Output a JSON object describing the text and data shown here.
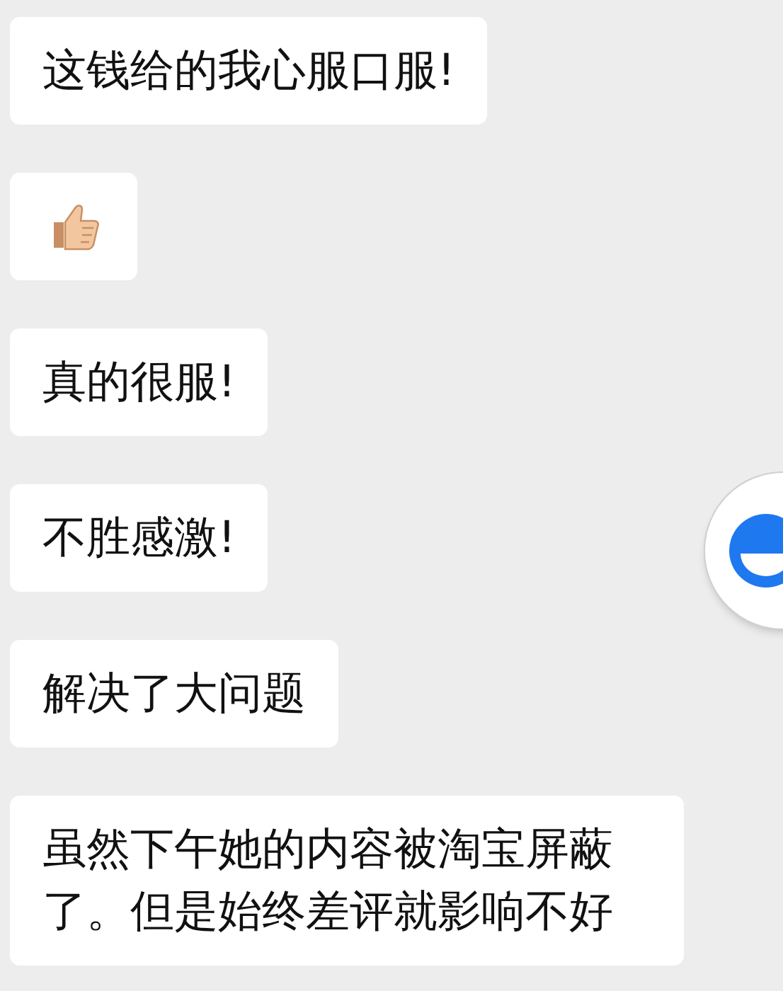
{
  "messages": [
    {
      "kind": "text",
      "text": "这钱给的我心服口服!"
    },
    {
      "kind": "thumbs_up"
    },
    {
      "kind": "text",
      "text": "真的很服!"
    },
    {
      "kind": "text",
      "text": "不胜感激!"
    },
    {
      "kind": "text",
      "text": "解决了大问题"
    },
    {
      "kind": "text",
      "text": "虽然下午她的内容被淘宝屏蔽了。但是始终差评就影响不好"
    }
  ]
}
